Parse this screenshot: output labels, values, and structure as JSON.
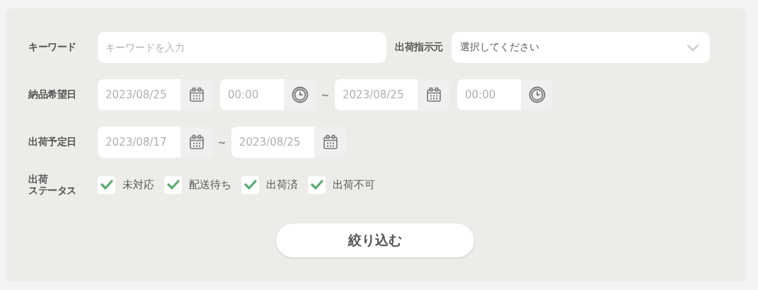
{
  "keyword": {
    "label": "キーワード",
    "placeholder": "キーワードを入力"
  },
  "source": {
    "label": "出荷指示元",
    "value": "選択してください"
  },
  "delivery_date": {
    "label": "納品希望日",
    "from_date": "2023/08/25",
    "from_time": "00:00",
    "separator": "～",
    "to_date": "2023/08/25",
    "to_time": "00:00"
  },
  "ship_date": {
    "label": "出荷予定日",
    "from_date": "2023/08/17",
    "separator": "～",
    "to_date": "2023/08/25"
  },
  "status": {
    "label_lines": [
      "出荷",
      "ステータス"
    ],
    "options": [
      {
        "label": "未対応",
        "checked": true
      },
      {
        "label": "配送待ち",
        "checked": true
      },
      {
        "label": "出荷済",
        "checked": true
      },
      {
        "label": "出荷不可",
        "checked": true
      }
    ]
  },
  "button": {
    "label": "絞り込む"
  }
}
